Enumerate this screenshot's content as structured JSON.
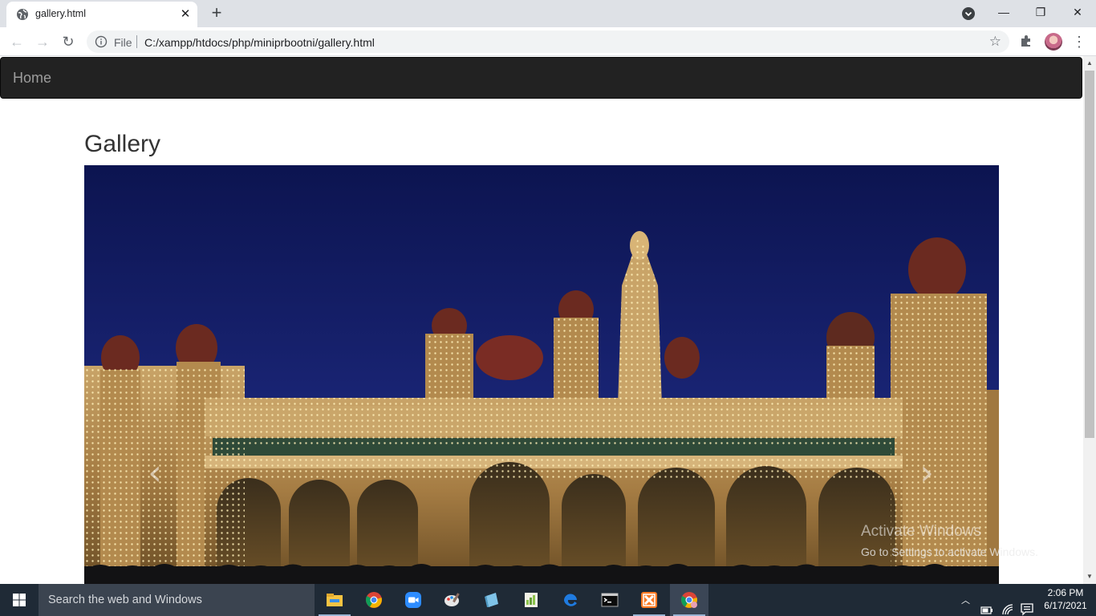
{
  "browser": {
    "tab": {
      "title": "gallery.html",
      "favicon": "globe-icon"
    },
    "new_tab_symbol": "+",
    "window_controls": {
      "minimize": "—",
      "restore": "❐",
      "close": "✕"
    },
    "omnibox": {
      "scheme": "File",
      "url": "C:/xampp/htdocs/php/miniprbootni/gallery.html"
    }
  },
  "page": {
    "navbar": {
      "brand": "Home"
    },
    "heading": "Gallery",
    "carousel": {
      "image_subject": "illuminated-palace-at-night",
      "prev_symbol": "‹",
      "next_symbol": "›"
    }
  },
  "watermark": {
    "title": "Activate Windows",
    "subtitle": "Go to Settings to activate Windows."
  },
  "taskbar": {
    "search_placeholder": "Search the web and Windows",
    "apps": [
      "file-explorer-icon",
      "chrome-icon",
      "zoom-icon",
      "paint-icon",
      "notepad-icon",
      "notepad-plus-icon",
      "edge-icon",
      "cmd-icon",
      "xampp-icon",
      "chrome-active-icon"
    ],
    "clock": {
      "time": "2:06 PM",
      "date": "6/17/2021"
    }
  },
  "colors": {
    "navbar_bg": "#222222",
    "navbar_text": "#9d9d9d",
    "sky": "#101a5a",
    "lights": "#f2d27a",
    "taskbar": "#1f2a36"
  }
}
